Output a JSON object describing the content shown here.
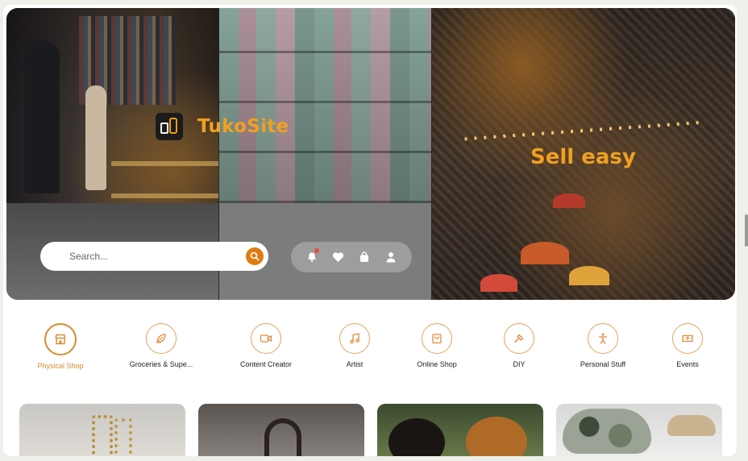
{
  "brand": {
    "name": "TukoSite"
  },
  "hero": {
    "tagline": "Sell easy"
  },
  "search": {
    "placeholder": "Search..."
  },
  "header_icons": [
    "bell-icon",
    "heart-icon",
    "bag-icon",
    "user-icon"
  ],
  "categories": [
    {
      "label": "Physical Shop",
      "icon": "store-icon",
      "active": true
    },
    {
      "label": "Groceries & Supe...",
      "icon": "leaf-icon",
      "active": false
    },
    {
      "label": "Content Creator",
      "icon": "video-icon",
      "active": false
    },
    {
      "label": "Artist",
      "icon": "music-icon",
      "active": false
    },
    {
      "label": "Online Shop",
      "icon": "shopping-bag-icon",
      "active": false
    },
    {
      "label": "DIY",
      "icon": "hammer-icon",
      "active": false
    },
    {
      "label": "Personal Stuff",
      "icon": "person-icon",
      "active": false
    },
    {
      "label": "Events",
      "icon": "ticket-icon",
      "active": false
    }
  ],
  "colors": {
    "accent": "#e07b12",
    "brand_text": "#f0a020",
    "ring": "#e8a25e"
  }
}
